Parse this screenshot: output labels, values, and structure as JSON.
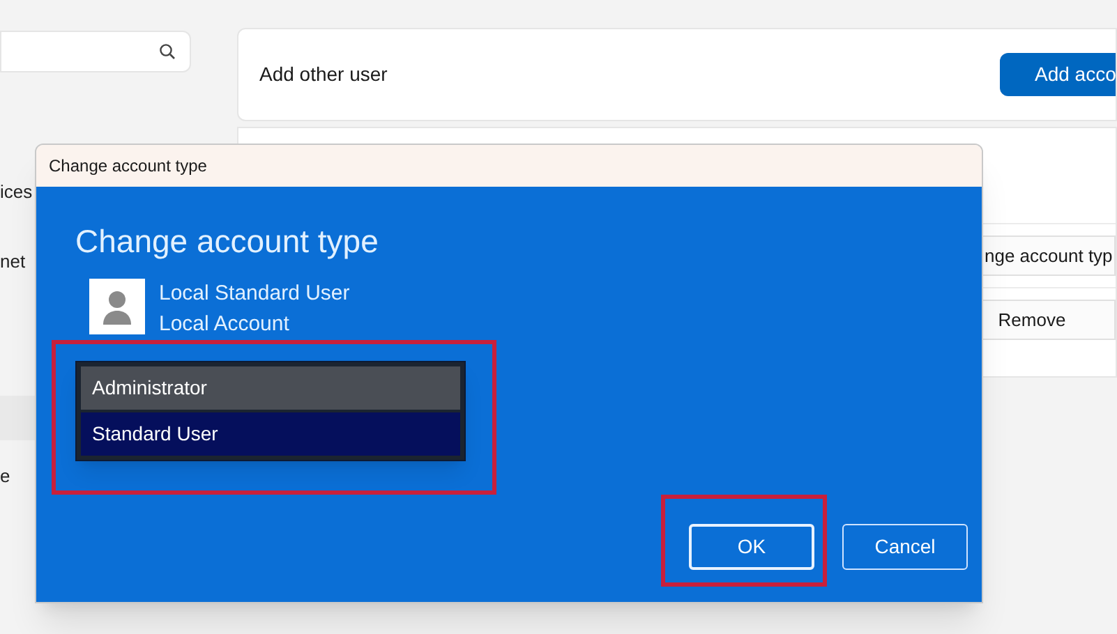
{
  "settings": {
    "sidebar": {
      "items": [
        {
          "label": "ices"
        },
        {
          "label": "net"
        },
        {
          "label": "e"
        }
      ]
    },
    "cards": [
      {
        "label": "Add other user",
        "button": "Add acco"
      },
      {
        "rows": [
          {
            "button": "nge account typ"
          },
          {
            "button": "Remove"
          }
        ]
      }
    ]
  },
  "dialog": {
    "window_title": "Change account type",
    "heading": "Change account type",
    "user": {
      "name": "Local Standard User",
      "account": "Local Account"
    },
    "options": [
      {
        "label": "Administrator",
        "selected": false,
        "hovered": true
      },
      {
        "label": "Standard User",
        "selected": true,
        "hovered": false
      }
    ],
    "options_highlighted": true,
    "buttons": [
      {
        "label": "OK",
        "focused": true,
        "highlighted": true
      },
      {
        "label": "Cancel",
        "focused": false,
        "highlighted": false
      }
    ]
  }
}
